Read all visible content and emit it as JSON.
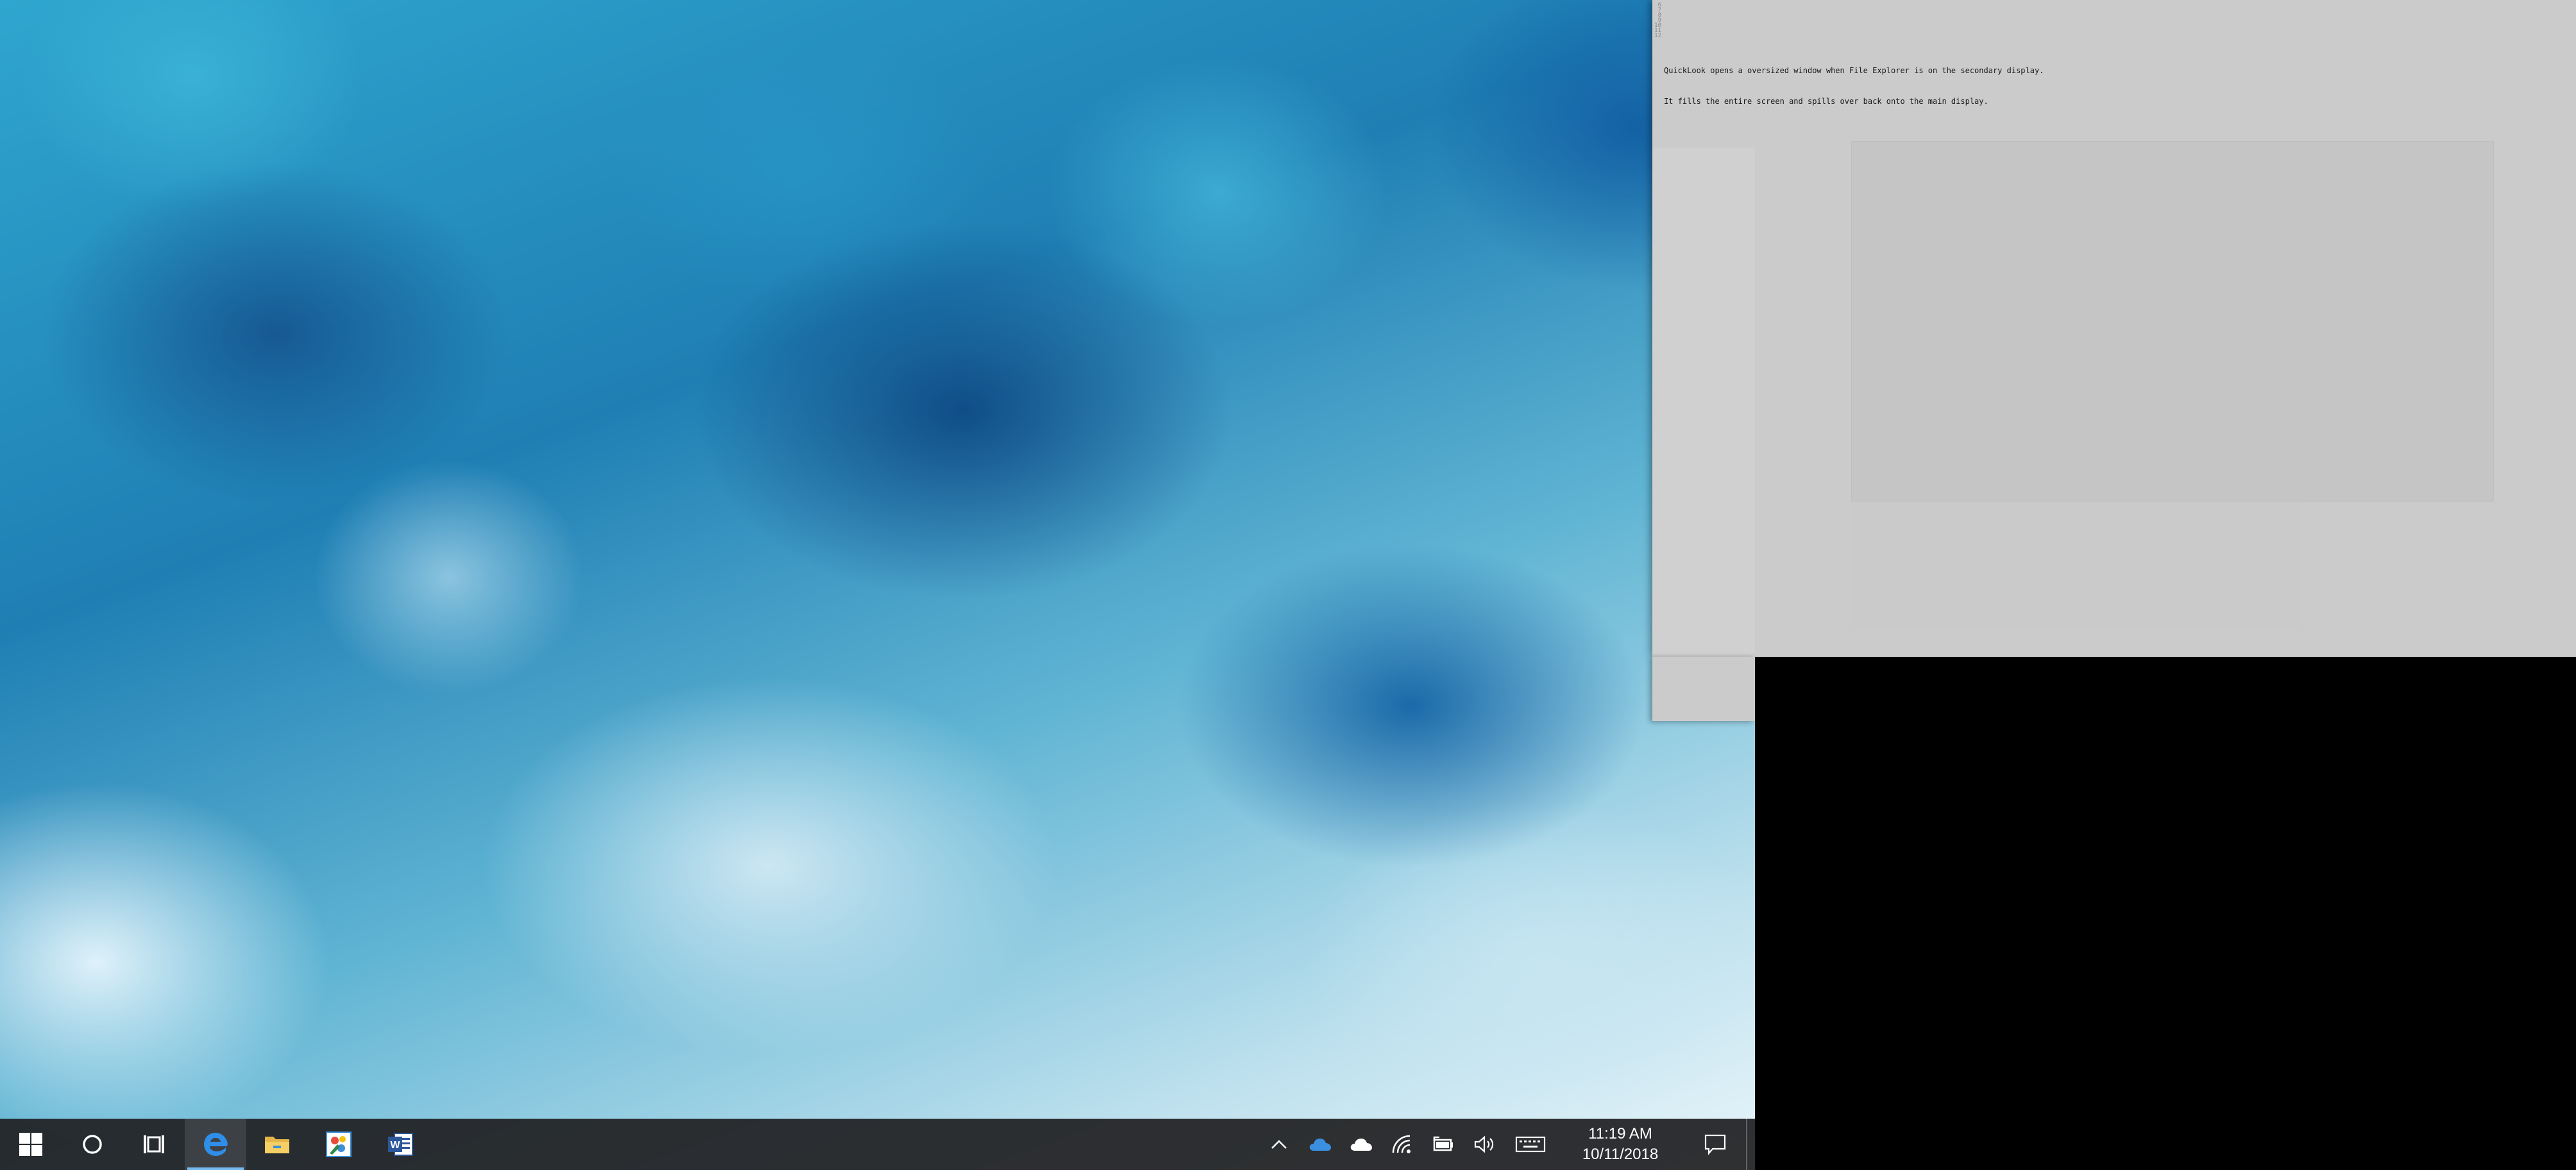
{
  "desktop": {
    "wallpaper": "blue-watercolor-wallpaper"
  },
  "quicklook": {
    "gutter_lines": [
      "6",
      "7",
      "8",
      "9",
      "10",
      "11",
      "12"
    ],
    "text_line_1": "QuickLook opens a oversized window when File Explorer is on the secondary display.",
    "text_line_2": "It fills the entire screen and spills over back onto the main display."
  },
  "taskbar": {
    "start_icon": "windows-logo-icon",
    "search_icon": "cortana-circle-icon",
    "task_view_icon": "task-view-icon",
    "pinned_apps": [
      {
        "name": "Microsoft Edge",
        "icon": "edge-icon",
        "active": true
      },
      {
        "name": "File Explorer",
        "icon": "folder-icon",
        "active": false
      },
      {
        "name": "Snipping/Paint app",
        "icon": "paint-app-icon",
        "active": false
      },
      {
        "name": "Microsoft Word",
        "icon": "word-icon",
        "active": false
      }
    ],
    "tray": {
      "icons": [
        "chevron-up-icon",
        "onedrive-blue-icon",
        "onedrive-white-icon",
        "wifi-icon",
        "battery-icon",
        "volume-icon",
        "keyboard-icon"
      ],
      "time": "11:19 AM",
      "date": "10/11/2018",
      "notification_icon": "action-center-icon"
    }
  },
  "colors": {
    "taskbar_bg": "#202022",
    "accent": "#76b9ed",
    "quicklook_bg": "#cbcbcb",
    "secondary_bg": "#000000"
  }
}
